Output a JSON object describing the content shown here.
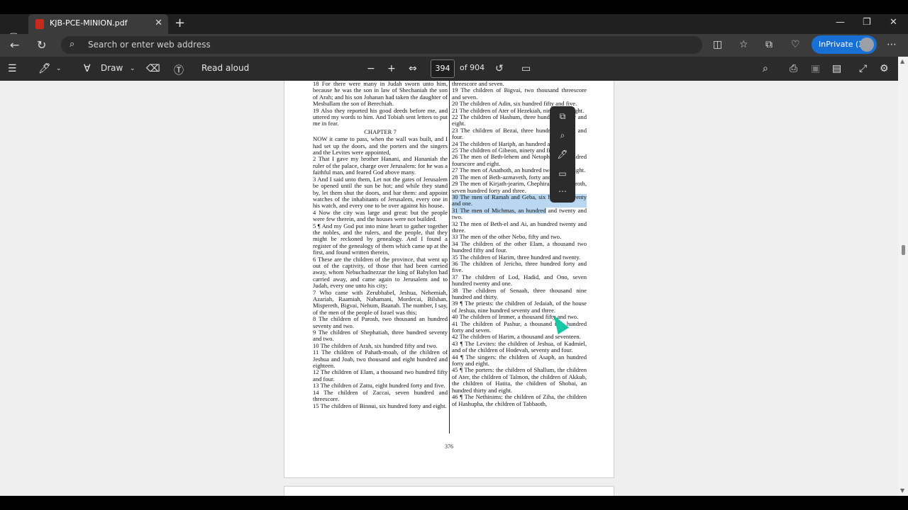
{
  "tab": {
    "title": "KJB-PCE-MINION.pdf",
    "close": "✕"
  },
  "window": {
    "minimize": "—",
    "restore": "❐",
    "close": "✕",
    "newtab": "+"
  },
  "address": {
    "placeholder": "Search or enter web address"
  },
  "inprivate": {
    "label": "InPrivate (2)"
  },
  "pdf_toolbar": {
    "draw": "Draw",
    "read_aloud": "Read aloud",
    "page_current": "394",
    "page_total": "of 904"
  },
  "page": {
    "number": "376",
    "chapter": "CHAPTER 7",
    "left": [
      "18 For there were many in Judah sworn unto him, because he was the son in law of Shechaniah the son of Arah; and his son Johanan had taken the daughter of Meshullam the son of Berechiah.",
      "19 Also they reported his good deeds before me, and uttered my words to him. And Tobiah sent letters to put me in fear."
    ],
    "left_ch7": [
      "NOW it came to pass, when the wall was built, and I had set up the doors, and the porters and the singers and the Levites were appointed,",
      "2 That I gave my brother Hanani, and Hananiah the ruler of the palace, charge over Jerusalem: for he was a faithful man, and feared God above many.",
      "3 And I said unto them, Let not the gates of Jerusalem be opened until the sun be hot; and while they stand by, let them shut the doors, and bar them: and appoint watches of the inhabitants of Jerusalem, every one in his watch, and every one to be over against his house.",
      "4 Now the city was large and great: but the people were few therein, and the houses were not builded.",
      "5 ¶ And my God put into mine heart to gather together the nobles, and the rulers, and the people, that they might be reckoned by genealogy. And I found a register of the genealogy of them which came up at the first, and found written therein,",
      "6 These are the children of the province, that went up out of the captivity, of those that had been carried away, whom Nebuchadnezzar the king of Babylon had carried away, and came again to Jerusalem and to Judah, every one unto his city;",
      "7 Who came with Zerubbabel, Jeshua, Nehemiah, Azariah, Raamiah, Nahamani, Mordecai, Bilshan, Mispereth, Bigvai, Nehum, Baanah. The number, I say, of the men of the people of Israel was this;",
      "8 The children of Parosh, two thousand an hundred seventy and two.",
      "9 The children of Shephatiah, three hundred seventy and two.",
      "10 The children of Arah, six hundred fifty and two.",
      "11 The children of Pahath-moab, of the children of Jeshua and Joab, two thousand and eight hundred and eighteen.",
      "12 The children of Elam, a thousand two hundred fifty and four.",
      "13 The children of Zattu, eight hundred forty and five.",
      "14 The children of Zaccai, seven hundred and threescore.",
      "15 The children of Binnui, six hundred forty and eight."
    ],
    "right_top": [
      "threescore and seven.",
      "19 The children of Bigvai, two thousand threescore and seven.",
      "20 The children of Adin, six hundred fifty and five.",
      "21 The children of Ater of Hezekiah, ninety and eight.",
      "22 The children of Hashum, three hundred twenty and eight.",
      "23 The children of Bezai, three hundred twenty and four.",
      "24 The children of Hariph, an hundred and twelve.",
      "25 The children of Gibeon, ninety and five.",
      "26 The men of Beth-lehem and Netophah, an hundred fourscore and eight.",
      "27 The men of Anathoth, an hundred twenty and eight.",
      "28 The men of Beth-azmaveth, forty and two.",
      "29 The men of Kirjath-jearim, Chephirah, and Beeroth, seven hundred forty and three."
    ],
    "right_hl": [
      "30 The men of Ramah and Geba, six hundred twenty and one.",
      "31 The men of Michmas, an hundred"
    ],
    "right_hl_tail": " and twenty and two.",
    "right_rest": [
      "32 The men of Beth-el and Ai, an hundred twenty and three.",
      "33 The men of the other Nebo, fifty and two.",
      "34 The children of the other Elam, a thousand two hundred fifty and four.",
      "35 The children of Harim, three hundred and twenty.",
      "36 The children of Jericho, three hundred forty and five.",
      "37 The children of Lod, Hadid, and Ono, seven hundred twenty and one.",
      "38 The children of Senaah, three thousand nine hundred and thirty.",
      "39 ¶ The priests: the children of Jedaiah, of the house of Jeshua, nine hundred seventy and three.",
      "40 The children of Immer, a thousand fifty and two.",
      "41 The children of Pashur, a thousand two hundred forty and seven.",
      "42 The children of Harim, a thousand and seventeen.",
      "43 ¶ The Levites: the children of Jeshua, of Kadmiel, and of the children of Hodevah, seventy and four.",
      "44 ¶ The singers: the children of Asaph, an hundred forty and eight.",
      "45 ¶ The porters: the children of Shallum, the children of Ater, the children of Talmon, the children of Akkub, the children of Hatita, the children of Shobai, an hundred thirty and eight.",
      "46 ¶ The Nethinims: the children of Ziha, the children of Hashupha, the children of Tabbaoth,"
    ]
  },
  "colors": {
    "accent": "#1870d5",
    "highlight": "#b9d7f0",
    "cursor": "#16c9a4"
  }
}
